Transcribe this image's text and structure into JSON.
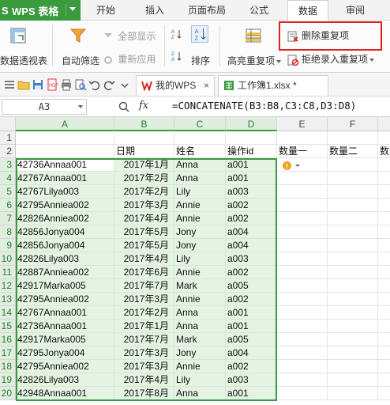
{
  "menubar": {
    "app_title": "WPS 表格",
    "tabs": [
      "开始",
      "插入",
      "页面布局",
      "公式",
      "数据",
      "审阅"
    ],
    "active_tab": "数据"
  },
  "ribbon": {
    "pivot_label": "数据透视表",
    "autofilter_label": "自动筛选",
    "show_all_label": "全部显示",
    "reapply_label": "重新应用",
    "sort_label": "排序",
    "highlight_dup_label": "高亮重复项",
    "remove_dup_label": "删除重复项",
    "reject_dup_label": "拒绝录入重复项"
  },
  "doc_tabs": {
    "home_tab": "我的WPS",
    "file_tab": "工作簿1.xlsx *"
  },
  "formula_bar": {
    "name_box": "A3",
    "fx": "fx",
    "formula": "=CONCATENATE(B3:B8,C3:C8,D3:D8)"
  },
  "grid": {
    "columns": [
      "A",
      "B",
      "C",
      "D",
      "E",
      "F"
    ],
    "row2": [
      "",
      "日期",
      "姓名",
      "操作id",
      "数量一",
      "数量二",
      "数"
    ],
    "rows": [
      {
        "n": "3",
        "a": "42736Annaa001",
        "b": "2017年1月",
        "c": "Anna",
        "d": "a001"
      },
      {
        "n": "4",
        "a": "42767Annaa001",
        "b": "2017年2月",
        "c": "Anna",
        "d": "a001"
      },
      {
        "n": "5",
        "a": "42767Lilya003",
        "b": "2017年2月",
        "c": "Lily",
        "d": "a003"
      },
      {
        "n": "6",
        "a": "42795Anniea002",
        "b": "2017年3月",
        "c": "Annie",
        "d": "a002"
      },
      {
        "n": "7",
        "a": "42826Anniea002",
        "b": "2017年4月",
        "c": "Annie",
        "d": "a002"
      },
      {
        "n": "8",
        "a": "42856Jonya004",
        "b": "2017年5月",
        "c": "Jony",
        "d": "a004"
      },
      {
        "n": "9",
        "a": "42856Jonya004",
        "b": "2017年5月",
        "c": "Jony",
        "d": "a004"
      },
      {
        "n": "10",
        "a": "42826Lilya003",
        "b": "2017年4月",
        "c": "Lily",
        "d": "a003"
      },
      {
        "n": "11",
        "a": "42887Anniea002",
        "b": "2017年6月",
        "c": "Annie",
        "d": "a002"
      },
      {
        "n": "12",
        "a": "42917Marka005",
        "b": "2017年7月",
        "c": "Mark",
        "d": "a005"
      },
      {
        "n": "13",
        "a": "42795Anniea002",
        "b": "2017年3月",
        "c": "Annie",
        "d": "a002"
      },
      {
        "n": "14",
        "a": "42767Annaa001",
        "b": "2017年2月",
        "c": "Anna",
        "d": "a001"
      },
      {
        "n": "15",
        "a": "42736Annaa001",
        "b": "2017年1月",
        "c": "Anna",
        "d": "a001"
      },
      {
        "n": "16",
        "a": "42917Marka005",
        "b": "2017年7月",
        "c": "Mark",
        "d": "a005"
      },
      {
        "n": "17",
        "a": "42795Jonya004",
        "b": "2017年3月",
        "c": "Jony",
        "d": "a004"
      },
      {
        "n": "18",
        "a": "42795Anniea002",
        "b": "2017年3月",
        "c": "Annie",
        "d": "a002"
      },
      {
        "n": "19",
        "a": "42826Lilya003",
        "b": "2017年4月",
        "c": "Lily",
        "d": "a003"
      },
      {
        "n": "20",
        "a": "42948Annaa001",
        "b": "2017年8月",
        "c": "Anna",
        "d": "a001"
      }
    ]
  },
  "colors": {
    "accent_green": "#3a9a3e",
    "selection_fill": "#e4f3e2",
    "highlight_red": "#e02020"
  }
}
